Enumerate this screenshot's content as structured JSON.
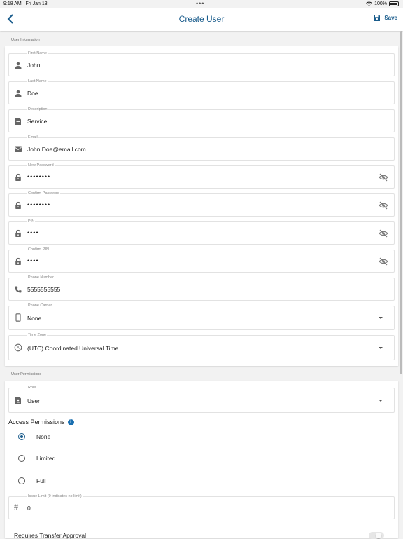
{
  "status": {
    "time": "9:18 AM",
    "date": "Fri Jan 13",
    "battery": "100%"
  },
  "header": {
    "title": "Create User",
    "save_label": "Save"
  },
  "user_info": {
    "section_label": "User Information",
    "first_name": {
      "label": "First Name",
      "value": "John"
    },
    "last_name": {
      "label": "Last Name",
      "value": "Doe"
    },
    "description": {
      "label": "Description",
      "value": "Service"
    },
    "email": {
      "label": "Email",
      "value": "John.Doe@email.com"
    },
    "new_password": {
      "label": "New Password",
      "value": "••••••••"
    },
    "confirm_password": {
      "label": "Confirm Password",
      "value": "••••••••"
    },
    "pin": {
      "label": "PIN",
      "value": "••••"
    },
    "confirm_pin": {
      "label": "Confirm PIN",
      "value": "••••"
    },
    "phone": {
      "label": "Phone Number",
      "value": "5555555555"
    },
    "carrier": {
      "label": "Phone Carrier",
      "value": "None"
    },
    "timezone": {
      "label": "Time Zone",
      "value": "(UTC) Coordinated Universal Time"
    }
  },
  "permissions": {
    "section_label": "User Permissions",
    "role": {
      "label": "Role",
      "value": "User"
    },
    "access_title": "Access Permissions",
    "options": [
      {
        "label": "None",
        "selected": true
      },
      {
        "label": "Limited",
        "selected": false
      },
      {
        "label": "Full",
        "selected": false
      }
    ],
    "issue_limit": {
      "label": "Issue Limit (0 indicates no limit)",
      "value": "0"
    },
    "transfer_approval": {
      "label": "Requires Transfer Approval",
      "on": false
    }
  },
  "colors": {
    "accent": "#1a5c8c",
    "info": "#1a6fb0"
  }
}
